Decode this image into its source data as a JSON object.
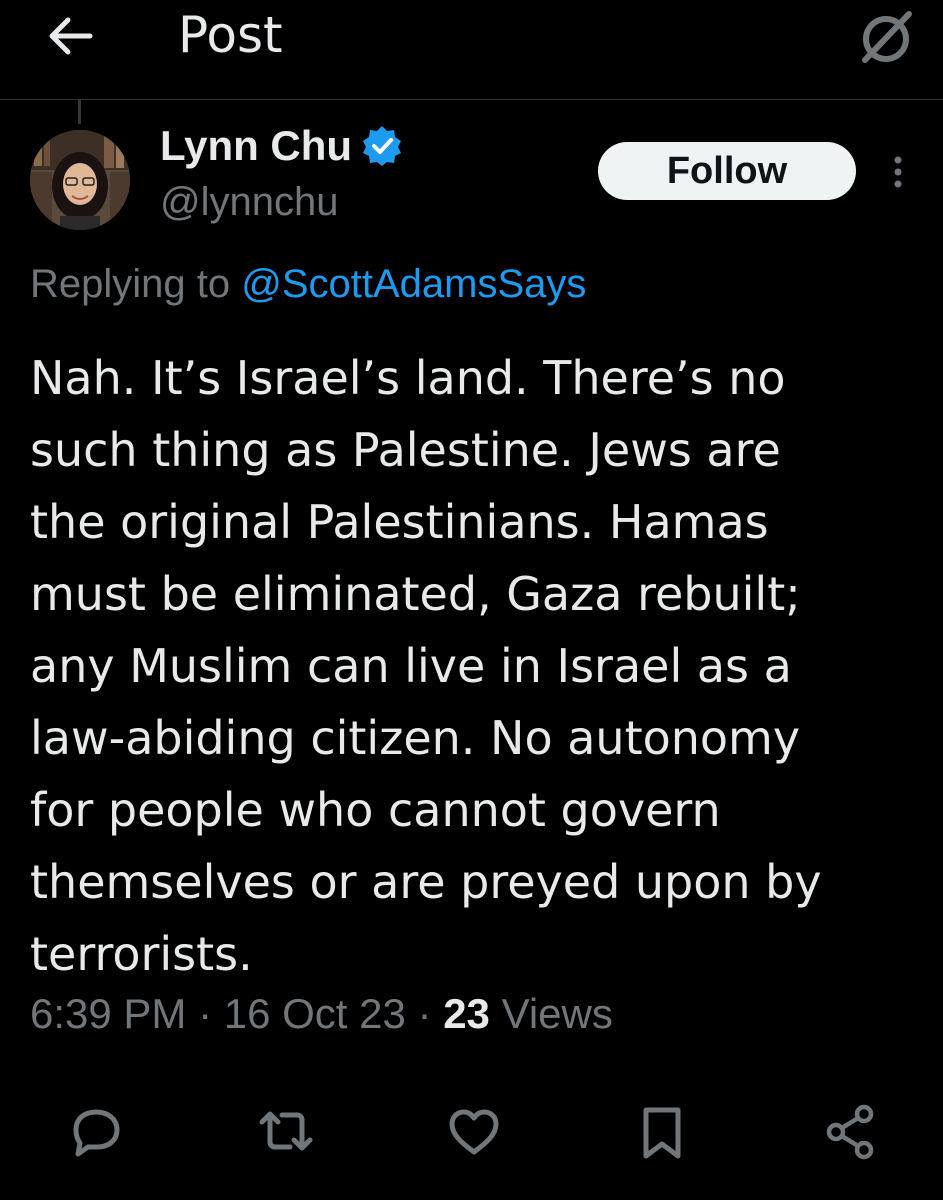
{
  "header": {
    "title": "Post",
    "back_icon": "arrow-left-icon",
    "grok_icon": "grok-icon"
  },
  "author": {
    "display_name": "Lynn Chu",
    "handle": "@lynnchu",
    "verified": true,
    "verified_color": "#1d9bf0"
  },
  "follow_button": {
    "label": "Follow"
  },
  "reply_context": {
    "prefix": "Replying to ",
    "mention": "@ScottAdamsSays"
  },
  "tweet": {
    "text": "Nah. It’s Israel’s land. There’s no\nsuch thing as Palestine. Jews are\nthe original Palestinians. Hamas\nmust be eliminated, Gaza rebuilt;\nany Muslim can live in Israel as a\nlaw-abiding citizen. No autonomy\nfor people who cannot govern\nthemselves or are preyed upon by\nterrorists."
  },
  "meta": {
    "time": "6:39 PM",
    "date": "16 Oct 23",
    "views_count": "23",
    "views_label": "Views",
    "separator": " · "
  },
  "actions": [
    {
      "name": "reply",
      "icon": "comment-icon"
    },
    {
      "name": "repost",
      "icon": "repost-icon"
    },
    {
      "name": "like",
      "icon": "heart-icon"
    },
    {
      "name": "bookmark",
      "icon": "bookmark-icon"
    },
    {
      "name": "share",
      "icon": "share-icon"
    }
  ],
  "colors": {
    "background": "#000000",
    "primary_text": "#e7e9ea",
    "secondary_text": "#71767b",
    "accent": "#1d9bf0",
    "follow_bg": "#eff3f4"
  }
}
